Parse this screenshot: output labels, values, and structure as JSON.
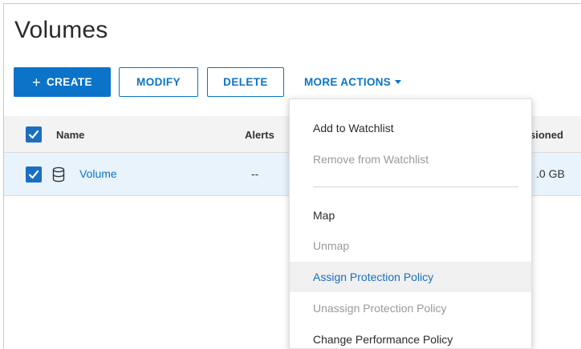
{
  "page": {
    "title": "Volumes"
  },
  "toolbar": {
    "create_plus": "+",
    "create_label": "CREATE",
    "modify_label": "MODIFY",
    "delete_label": "DELETE",
    "more_actions_label": "MORE ACTIONS"
  },
  "table": {
    "headers": {
      "name": "Name",
      "alerts": "Alerts",
      "provisioned": "sioned"
    },
    "rows": [
      {
        "name": "Volume",
        "alerts": "--",
        "provisioned": ".0 GB",
        "selected": true
      }
    ]
  },
  "menu": {
    "items": [
      {
        "label": "Add to Watchlist",
        "state": "enabled"
      },
      {
        "label": "Remove from Watchlist",
        "state": "disabled"
      },
      {
        "label": "Map",
        "state": "enabled"
      },
      {
        "label": "Unmap",
        "state": "disabled"
      },
      {
        "label": "Assign Protection Policy",
        "state": "hover"
      },
      {
        "label": "Unassign Protection Policy",
        "state": "disabled"
      },
      {
        "label": "Change Performance Policy",
        "state": "enabled"
      }
    ]
  },
  "colors": {
    "accent": "#0b74c8",
    "checkbox": "#1a6fc0",
    "selected_row": "#e9f3fb",
    "disabled_text": "#9a9a9a",
    "menu_hover_bg": "#f0f0f0"
  },
  "icons": {
    "checkbox": "check-icon",
    "volume": "database-icon",
    "dropdown": "caret-down-icon"
  }
}
